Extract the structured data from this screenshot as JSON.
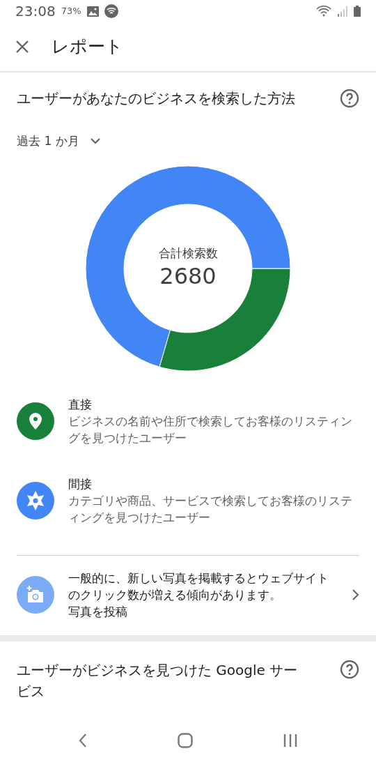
{
  "status_bar": {
    "time": "23:08",
    "battery_text": "73%"
  },
  "app_bar": {
    "title": "レポート"
  },
  "section": {
    "title": "ユーザーがあなたのビジネスを検索した方法",
    "period": "過去 1 か月",
    "chart_center": {
      "label": "合計検索数",
      "value": "2680"
    },
    "legend": [
      {
        "title": "直接",
        "description": "ビジネスの名前や住所で検索してお客様のリスティングを見つけたユーザー",
        "color": "#188038",
        "kind": "pin"
      },
      {
        "title": "間接",
        "description": "カテゴリや商品、サービスで検索してお客様のリスティングを見つけたユーザー",
        "color": "#4285f4",
        "kind": "compass"
      }
    ],
    "tip": {
      "text": "一般的に、新しい写真を掲載するとウェブサイトのクリック数が増える傾向があります。",
      "action": "写真を投稿"
    }
  },
  "next_section": {
    "title": "ユーザーがビジネスを見つけた Google サービス"
  }
}
